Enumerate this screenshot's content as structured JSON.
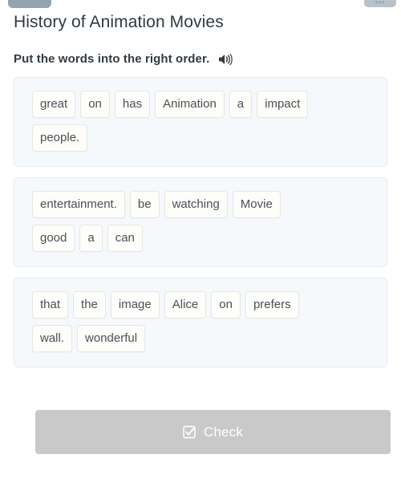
{
  "top_nav": {
    "left_button_label": "",
    "right_button_label": "",
    "right_button_glyph": "•••"
  },
  "header": {
    "title": "History of Animation Movies"
  },
  "task": {
    "instruction": "Put the words into the right order.",
    "audio_icon": "speaker-icon"
  },
  "word_groups": [
    {
      "id": "sentence-1",
      "rows": [
        [
          "great",
          "on",
          "has",
          "Animation",
          "a",
          "impact"
        ],
        [
          "people."
        ]
      ]
    },
    {
      "id": "sentence-2",
      "rows": [
        [
          "entertainment.",
          "be",
          "watching",
          "Movie"
        ],
        [
          "good",
          "a",
          "can"
        ]
      ]
    },
    {
      "id": "sentence-3",
      "rows": [
        [
          "that",
          "the",
          "image",
          "Alice",
          "on",
          "prefers"
        ],
        [
          "wall.",
          "wonderful"
        ]
      ]
    }
  ],
  "footer": {
    "check_label": "Check",
    "check_icon": "checkbox-checked-icon",
    "check_enabled": false
  },
  "colors": {
    "page_background": "#ffffff",
    "panel_background": "#f5f9fc",
    "panel_border": "#e4ecf2",
    "chip_background": "#fdfdfa",
    "chip_border": "#e6e6e2",
    "chip_text": "#4a5056",
    "title_text": "#2f3a40",
    "instruction_text": "#323b41",
    "button_background": "#c9c9c9",
    "button_text": "#ffffff",
    "nav_chip": "#93a4af"
  }
}
